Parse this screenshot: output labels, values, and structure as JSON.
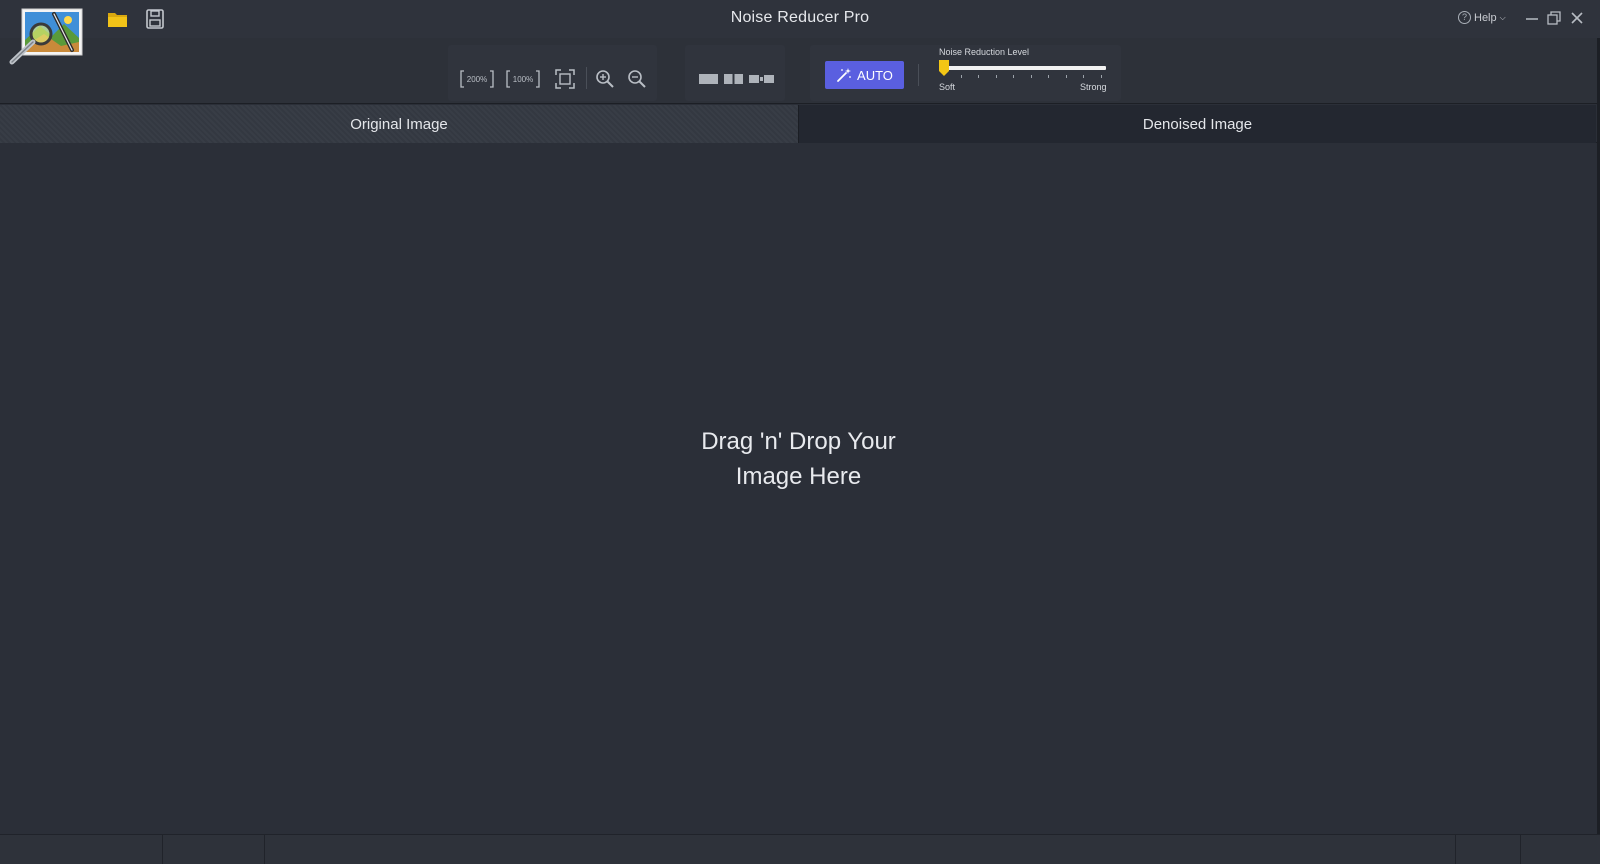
{
  "window": {
    "title": "Noise Reducer Pro",
    "help_label": "Help",
    "help_glyph": "?"
  },
  "toolbar": {
    "zoom_200_label": "200%",
    "zoom_100_label": "100%",
    "auto_label": "AUTO",
    "noise_reduction": {
      "title": "Noise Reduction Level",
      "min_label": "Soft",
      "max_label": "Strong",
      "level": 0,
      "thumb_color": "#f3c615"
    }
  },
  "tabs": {
    "original": "Original Image",
    "denoised": "Denoised Image"
  },
  "canvas": {
    "drop_line1": "Drag 'n' Drop Your",
    "drop_line2": "Image Here"
  },
  "colors": {
    "accent": "#5a5fe0",
    "folder": "#f2c318",
    "background": "#2b2f38"
  }
}
